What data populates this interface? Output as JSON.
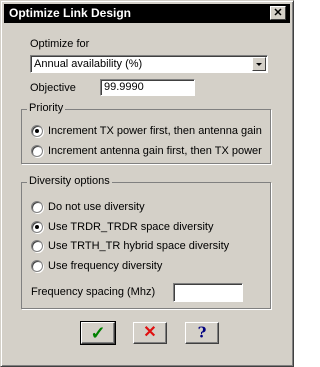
{
  "window": {
    "title": "Optimize Link Design",
    "close_glyph": "✕"
  },
  "optimize": {
    "label": "Optimize for",
    "selected": "Annual availability (%)",
    "objective_label": "Objective",
    "objective_value": "99.9990"
  },
  "priority": {
    "title": "Priority",
    "options": [
      {
        "label": "Increment TX power first, then antenna gain",
        "checked": true
      },
      {
        "label": "Increment antenna gain first, then TX power",
        "checked": false
      }
    ]
  },
  "diversity": {
    "title": "Diversity options",
    "options": [
      {
        "label": "Do not use diversity",
        "checked": false
      },
      {
        "label": "Use TRDR_TRDR space diversity",
        "checked": true
      },
      {
        "label": "Use TRTH_TR hybrid space diversity",
        "checked": false
      },
      {
        "label": "Use frequency diversity",
        "checked": false
      }
    ],
    "frequency_spacing_label": "Frequency spacing (Mhz)",
    "frequency_spacing_value": ""
  },
  "buttons": {
    "ok_icon": "✓",
    "cancel_icon": "✕",
    "help_icon": "?"
  },
  "colors": {
    "ok_green": "#008000",
    "cancel_red": "#e01010",
    "help_blue": "#000080"
  }
}
